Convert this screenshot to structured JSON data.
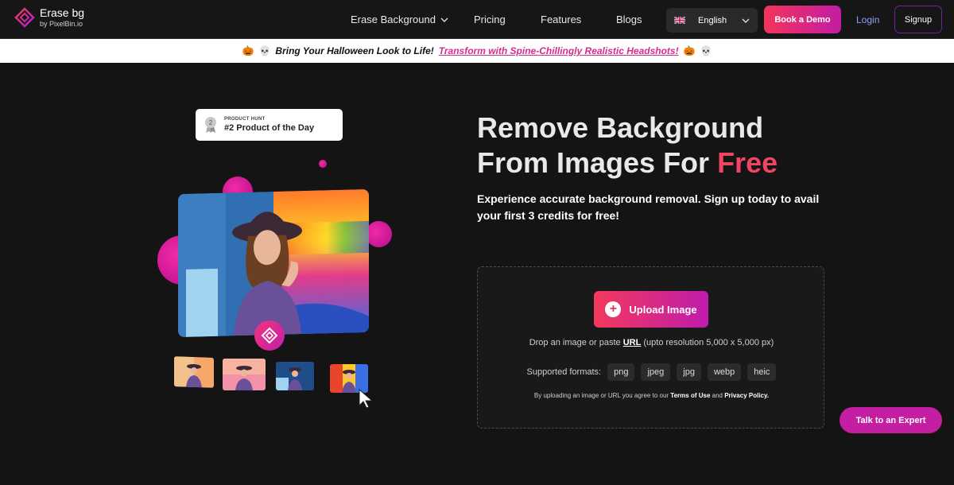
{
  "nav": {
    "logo_title": "Erase bg",
    "logo_sub": "by PixelBin.io",
    "links": [
      "Erase Background",
      "Pricing",
      "Features",
      "Blogs"
    ],
    "language": "English",
    "book_demo": "Book a Demo",
    "login": "Login",
    "signup": "Signup"
  },
  "banner": {
    "text": "Bring Your Halloween Look to Life!",
    "link": "Transform with Spine-Chillingly Realistic Headshots!"
  },
  "badge": {
    "small": "PRODUCT HUNT",
    "big": "#2 Product of the Day",
    "rank": "2"
  },
  "hero": {
    "title_line1": "Remove Background",
    "title_line2_a": "From Images For ",
    "title_free": "Free",
    "subtitle": "Experience accurate background removal. Sign up today to avail your first 3 credits for free!"
  },
  "upload": {
    "button": "Upload Image",
    "drop_a": "Drop an image or paste ",
    "drop_url": "URL",
    "drop_b": " (upto resolution 5,000 x 5,000 px)",
    "formats_label": "Supported formats:",
    "formats": [
      "png",
      "jpeg",
      "jpg",
      "webp",
      "heic"
    ],
    "terms_a": "By uploading an image or URL you agree to our ",
    "terms_link1": "Terms of Use",
    "terms_and": " and ",
    "terms_link2": "Privacy Policy."
  },
  "talk_button": "Talk to an Expert",
  "colors": {
    "accent_start": "#f4345b",
    "accent_end": "#c21ca4",
    "free": "#f04462",
    "background": "#141414"
  }
}
